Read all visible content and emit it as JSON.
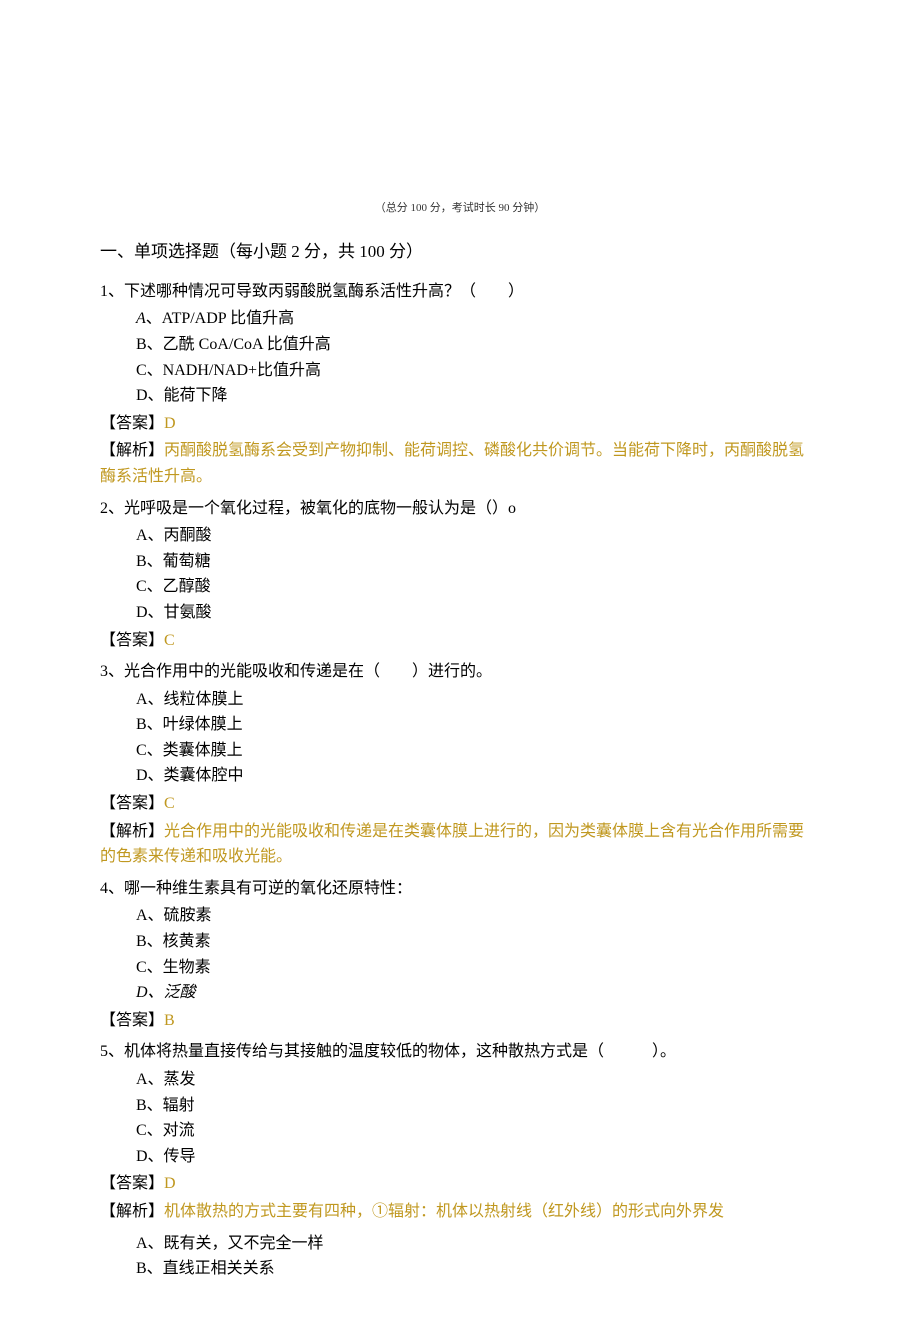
{
  "meta": "（总分 100 分，考试时长 90 分钟）",
  "sectionTitle": "一、单项选择题（每小题 2 分，共 100 分）",
  "q1": {
    "stem": "1、下述哪种情况可导致丙弱酸脱氢酶系活性升高？（　　）",
    "optA_prefix": "A",
    "optA_text": "、ATP/ADP 比值升高",
    "optB": "B、乙酰 CoA/CoA 比值升高",
    "optC": "C、NADH/NAD+比值升高",
    "optD": "D、能荷下降",
    "answerLabel": "【答案】",
    "answerVal": "D",
    "explLabel": "【解析】",
    "explText": "丙酮酸脱氢酶系会受到产物抑制、能荷调控、磷酸化共价调节。当能荷下降时，丙酮酸脱氢酶系活性升高。"
  },
  "q2": {
    "stem": "2、光呼吸是一个氧化过程，被氧化的底物一般认为是（）o",
    "optA": "A、丙酮酸",
    "optB": "B、葡萄糖",
    "optC": "C、乙醇酸",
    "optD": "D、甘氨酸",
    "answerLabel": "【答案】",
    "answerVal": "C"
  },
  "q3": {
    "stem": "3、光合作用中的光能吸收和传递是在（　　）进行的。",
    "optA": "A、线粒体膜上",
    "optB": "B、叶绿体膜上",
    "optC": "C、类囊体膜上",
    "optD": "D、类囊体腔中",
    "answerLabel": "【答案】",
    "answerVal": "C",
    "explLabel": "【解析】",
    "explText": "光合作用中的光能吸收和传递是在类囊体膜上进行的，因为类囊体膜上含有光合作用所需要的色素来传递和吸收光能。"
  },
  "q4": {
    "stem": "4、哪一种维生素具有可逆的氧化还原特性：",
    "optA": "A、硫胺素",
    "optB": "B、核黄素",
    "optC": "C、生物素",
    "optD": "D、泛酸",
    "answerLabel": "【答案】",
    "answerVal": "B"
  },
  "q5": {
    "stem": "5、机体将热量直接传给与其接触的温度较低的物体，这种散热方式是（　　　）。",
    "optA": "A、蒸发",
    "optB": "B、辐射",
    "optC": "C、对流",
    "optD": "D、传导",
    "answerLabel": "【答案】",
    "answerVal": "D",
    "explLabel": "【解析】",
    "explText": "机体散热的方式主要有四种，①辐射：机体以热射线（红外线）的形式向外界发"
  },
  "extra": {
    "optA": "A、既有关，又不完全一样",
    "optB": "B、直线正相关关系"
  }
}
